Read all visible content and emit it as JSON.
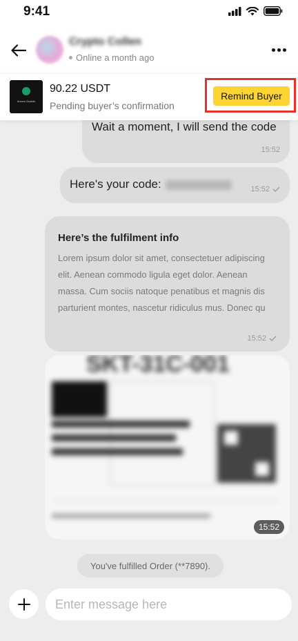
{
  "status_bar": {
    "time": "9:41"
  },
  "header": {
    "contact_name": "Crypto Collen",
    "presence": "Online a month ago"
  },
  "order": {
    "amount": "90.22 USDT",
    "status": "Pending buyer’s confirmation",
    "remind_label": "Remind Buyer",
    "thumb_text": "Aurora Guards"
  },
  "messages": [
    {
      "text": "Wait a moment, I will send the code",
      "time": "15:52"
    },
    {
      "text": "Here's your code:",
      "time": "15:52"
    },
    {
      "title": "Here’s the fulfilment info",
      "body": "Lorem ipsum dolor sit amet, consectetuer adipiscing elit. Aenean commodo ligula eget dolor. Aenean massa. Cum sociis natoque penatibus et magnis dis parturient montes, nascetur ridiculus mus. Donec qu",
      "time": "15:52"
    },
    {
      "type": "image",
      "time": "15:52",
      "image_text": "SKT-31C-001"
    }
  ],
  "system_message": "You've fulfilled Order (**7890).",
  "composer": {
    "placeholder": "Enter message here"
  }
}
